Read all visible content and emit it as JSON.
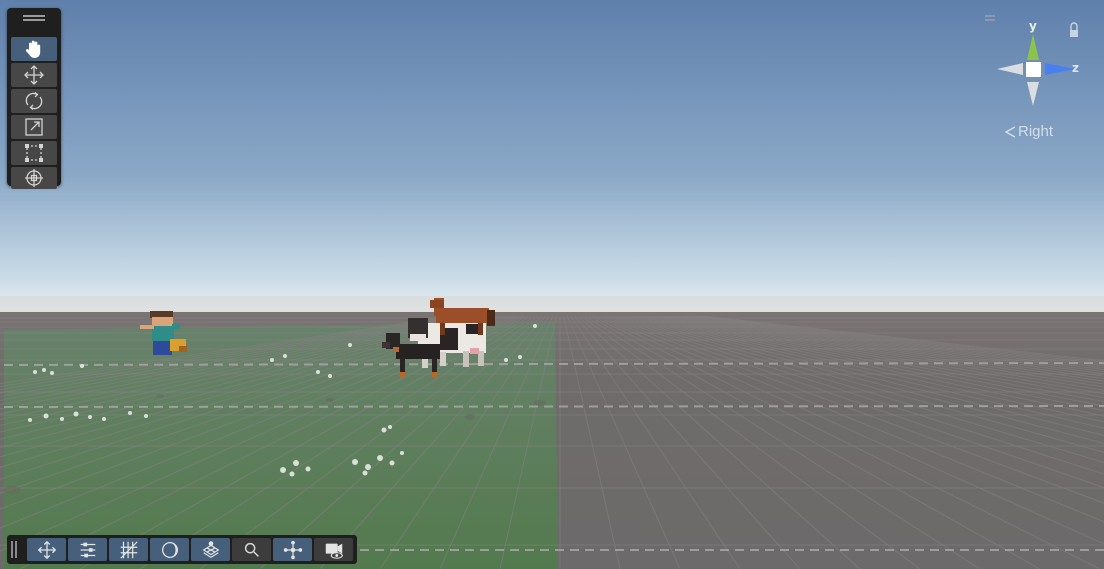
{
  "scene_view": {
    "tools": [
      {
        "name": "hand-tool",
        "icon": "hand-icon",
        "active": true
      },
      {
        "name": "move-tool",
        "icon": "move-arrows-icon",
        "active": false
      },
      {
        "name": "rotate-tool",
        "icon": "rotate-icon",
        "active": false
      },
      {
        "name": "scale-tool",
        "icon": "scale-icon",
        "active": false
      },
      {
        "name": "rect-tool",
        "icon": "rect-transform-icon",
        "active": false
      },
      {
        "name": "transform-tool",
        "icon": "transform-icon",
        "active": false
      }
    ],
    "overlays": [
      {
        "name": "move-overlay",
        "icon": "move-arrows-icon"
      },
      {
        "name": "properties-overlay",
        "icon": "sliders-icon"
      },
      {
        "name": "grid-overlay",
        "icon": "grid-icon"
      },
      {
        "name": "lighting-overlay",
        "icon": "moon-icon"
      },
      {
        "name": "layers-overlay",
        "icon": "layers-icon"
      },
      {
        "name": "search-overlay",
        "icon": "search-icon",
        "off": true
      },
      {
        "name": "gizmos-overlay",
        "icon": "gizmo-icon"
      },
      {
        "name": "camera-overlay",
        "icon": "camera-eye-icon",
        "off": true
      }
    ],
    "gizmo": {
      "y_label": "y",
      "z_label": "z",
      "view_label": "Right",
      "y_color": "#8ac44a",
      "z_color": "#4a7ff0"
    },
    "colors": {
      "accent": "#46607c",
      "panel": "#1f1f1f",
      "sky_top": "#5f80ac",
      "horizon": "#e8f0f4",
      "ground": "#6f6c6b",
      "grass": "#5b7d53"
    }
  }
}
